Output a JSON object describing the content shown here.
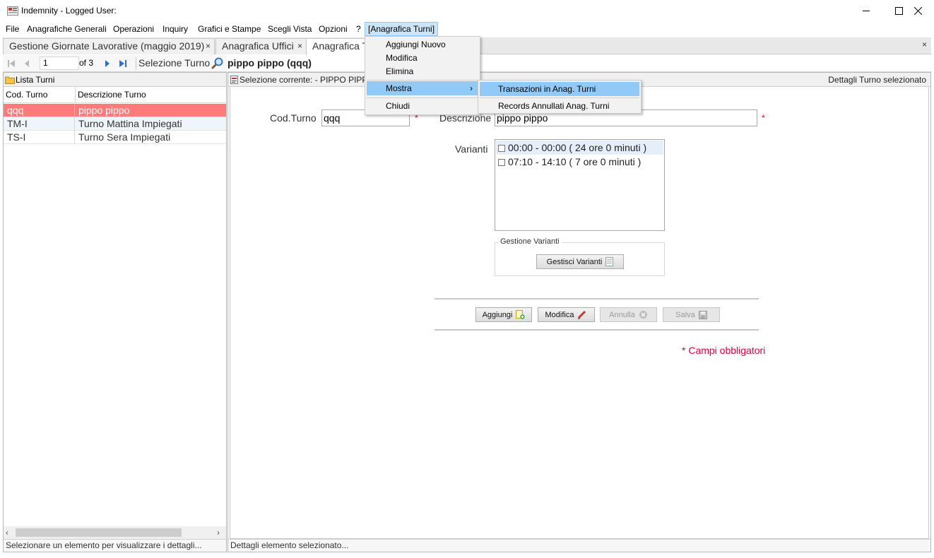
{
  "window": {
    "title": "Indemnity - Logged User: "
  },
  "menubar": {
    "items": [
      "File",
      "Anagrafiche Generali",
      "Operazioni",
      "Inquiry",
      "Grafici e Stampe",
      "Scegli Vista",
      "Opzioni",
      "?",
      "[Anagrafica Turni]"
    ]
  },
  "tabs": [
    {
      "label": "Gestione Giornate Lavorative (maggio 2019)",
      "close": "×",
      "active": false
    },
    {
      "label": "Anagrafica Uffici",
      "close": "×",
      "active": false
    },
    {
      "label": "Anagrafica Turni",
      "close": "",
      "active": true
    }
  ],
  "tabbar_close": "×",
  "navigator": {
    "position": "1",
    "count": "of 3",
    "selezione_label": "Selezione Turno"
  },
  "selected_record_title": "pippo pippo (qqq)",
  "left_panel": {
    "title": "Lista Turni",
    "columns": [
      "Cod. Turno",
      "Descrizione Turno"
    ],
    "rows": [
      {
        "cod": "qqq",
        "desc": "pippo pippo",
        "selected": true
      },
      {
        "cod": "TM-I",
        "desc": "Turno Mattina Impiegati",
        "selected": false
      },
      {
        "cod": "TS-I",
        "desc": "Turno Sera Impiegati",
        "selected": false
      }
    ],
    "scroll_left": "‹",
    "scroll_right": "›",
    "status": "Selezionare un elemento per visualizzare i dettagli..."
  },
  "right_panel": {
    "selezione_corrente": "Selezione corrente:  - PIPPO PIPPO",
    "header_right": "Dettagli Turno selezionato",
    "status": "Dettagli elemento selezionato..."
  },
  "form": {
    "cod_label": "Cod.Turno",
    "cod_value": "qqq",
    "desc_label": "Descrizione",
    "desc_value": "pippo pippo",
    "required_mark": "*",
    "varianti_label": "Varianti",
    "varianti": [
      {
        "label": "00:00 - 00:00  ( 24 ore 0 minuti )",
        "selected": true
      },
      {
        "label": "07:10 - 14:10  ( 7 ore 0 minuti )",
        "selected": false
      }
    ],
    "gestione_legend": "Gestione Varianti",
    "gestisci_button": "Gestisci Varianti",
    "buttons": {
      "aggiungi": "Aggiungi",
      "modifica": "Modifica",
      "annulla": "Annulla",
      "salva": "Salva"
    },
    "campi_obbligatori": "* Campi obbligatori"
  },
  "dropdown": {
    "items": [
      "Aggiungi Nuovo",
      "Modifica",
      "Elimina",
      "Mostra",
      "Chiudi"
    ],
    "submenu_arrow": "›",
    "submenu": [
      "Transazioni in Anag. Turni",
      "Records Annullati Anag. Turni"
    ]
  },
  "colors": {
    "selected_row": "#ff7b7b",
    "menu_highlight": "#91c9f7",
    "required": "#e0003c"
  }
}
